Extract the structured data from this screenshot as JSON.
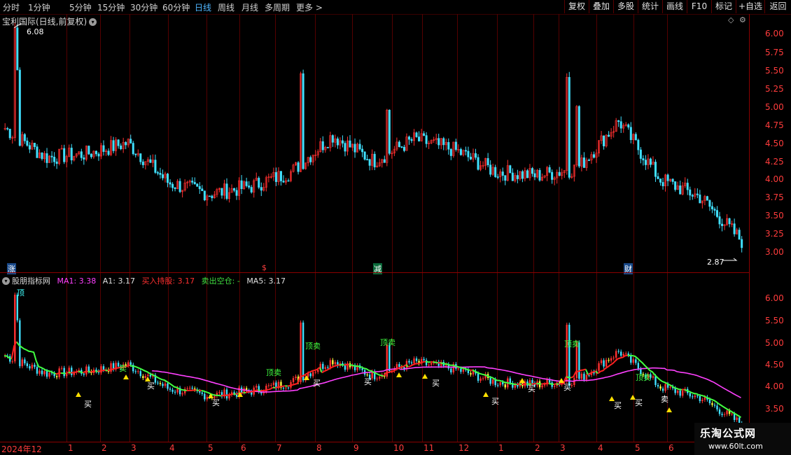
{
  "toolbar": {
    "timeframes": [
      "分时",
      "1分钟",
      "5分钟",
      "15分钟",
      "30分钟",
      "60分钟",
      "日线",
      "周线",
      "月线",
      "多周期",
      "更多 >"
    ],
    "active_index": 6,
    "buttons": [
      "复权",
      "叠加",
      "多股",
      "统计",
      "画线",
      "F10",
      "标记",
      "+自选",
      "返回"
    ]
  },
  "main_chart": {
    "title": "宝利国际(日线,前复权)",
    "y_ticks": [
      "6.00",
      "5.75",
      "5.50",
      "5.25",
      "5.00",
      "4.75",
      "4.50",
      "4.25",
      "4.00",
      "3.75",
      "3.50",
      "3.25",
      "3.00"
    ],
    "high_label": "6.08",
    "low_label": "2.87",
    "markers": [
      "涨",
      "$",
      "减",
      "财"
    ]
  },
  "indicator": {
    "name": "股朋指标网",
    "ma1_label": "MA1: 3.38",
    "a1_label": "A1: 3.17",
    "buy_label": "买入持股: 3.17",
    "sell_label": "卖出空仓: -",
    "ma5_label": "MA5: 3.17",
    "y_ticks": [
      "6.00",
      "5.50",
      "5.00",
      "4.50",
      "4.00",
      "3.50"
    ],
    "top_label": "顶",
    "buy_text": "买",
    "sell_text": "卖",
    "top_sell_text": "顶卖"
  },
  "dates": [
    "2024年12",
    "1",
    "2",
    "3",
    "4",
    "5",
    "6",
    "7",
    "8",
    "9",
    "10",
    "11",
    "12",
    "1",
    "2",
    "3",
    "4",
    "5",
    "6"
  ],
  "watermark": {
    "name": "乐淘公式网",
    "url": "www.60lt.com"
  },
  "chart_data": {
    "type": "line",
    "title": "宝利国际(日线,前复权)",
    "xlabel": "",
    "ylabel": "",
    "ylim": [
      2.87,
      6.08
    ],
    "x": [
      "2024-12",
      "2025-01",
      "2025-02",
      "2025-03",
      "2025-04",
      "2025-05",
      "2025-06",
      "2025-07",
      "2025-08",
      "2025-09",
      "2025-10",
      "2025-11",
      "2025-12",
      "2026-01",
      "2026-02",
      "2026-03",
      "2026-04",
      "2026-05",
      "2026-06"
    ],
    "series": [
      {
        "name": "",
        "values": [
          4.7,
          4.3,
          4.35,
          4.5,
          3.95,
          3.8,
          3.9,
          4.1,
          4.6,
          4.25,
          4.55,
          4.4,
          4.1,
          4.05,
          4.15,
          4.8,
          4.0,
          3.75,
          3.15
        ]
      }
    ],
    "annotations": [
      "6.08",
      "2.87"
    ]
  }
}
